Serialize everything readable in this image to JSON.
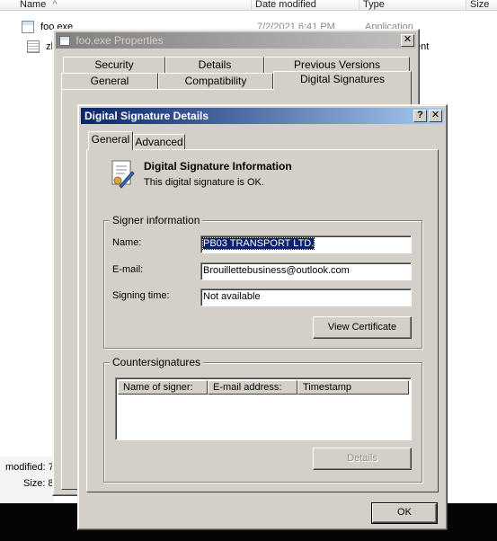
{
  "explorer": {
    "columns": [
      {
        "label": "Name",
        "sort": "^"
      },
      {
        "label": "Date modified"
      },
      {
        "label": "Type"
      },
      {
        "label": "Size"
      }
    ],
    "files": [
      {
        "name": "foo.exe",
        "date": "7/2/2021 6:41 PM",
        "type": "Application"
      },
      {
        "name": "zb",
        "type_tail": "ent"
      }
    ],
    "status": {
      "modified_label": "modified:",
      "modified_value": "7",
      "size_label": "Size:",
      "size_value": "8"
    }
  },
  "properties": {
    "title": "foo.exe Properties",
    "close_label": "✕",
    "tabs_top": [
      "Security",
      "Details",
      "Previous Versions"
    ],
    "tabs_bottom": [
      "General",
      "Compatibility",
      "Digital Signatures"
    ],
    "selected_tab": "Digital Signatures"
  },
  "details": {
    "title": "Digital Signature Details",
    "help_label": "?",
    "close_label": "✕",
    "tabs": [
      "General",
      "Advanced"
    ],
    "selected_tab": "General",
    "info_heading": "Digital Signature Information",
    "info_text": "This digital signature is OK.",
    "signer_group": "Signer information",
    "name_label": "Name:",
    "name_value": "PB03 TRANSPORT LTD.",
    "email_label": "E-mail:",
    "email_value": "Brouillettebusiness@outlook.com",
    "time_label": "Signing time:",
    "time_value": "Not available",
    "view_cert_label": "View Certificate",
    "counter_group": "Countersignatures",
    "counter_columns": [
      "Name of signer:",
      "E-mail address:",
      "Timestamp"
    ],
    "counter_rows": [],
    "details_button": "Details",
    "ok_button": "OK"
  },
  "colors": {
    "face": "#d4d0c8",
    "active_title": "#0a246a",
    "inactive_title": "#808080",
    "selection": "#0a246a"
  }
}
